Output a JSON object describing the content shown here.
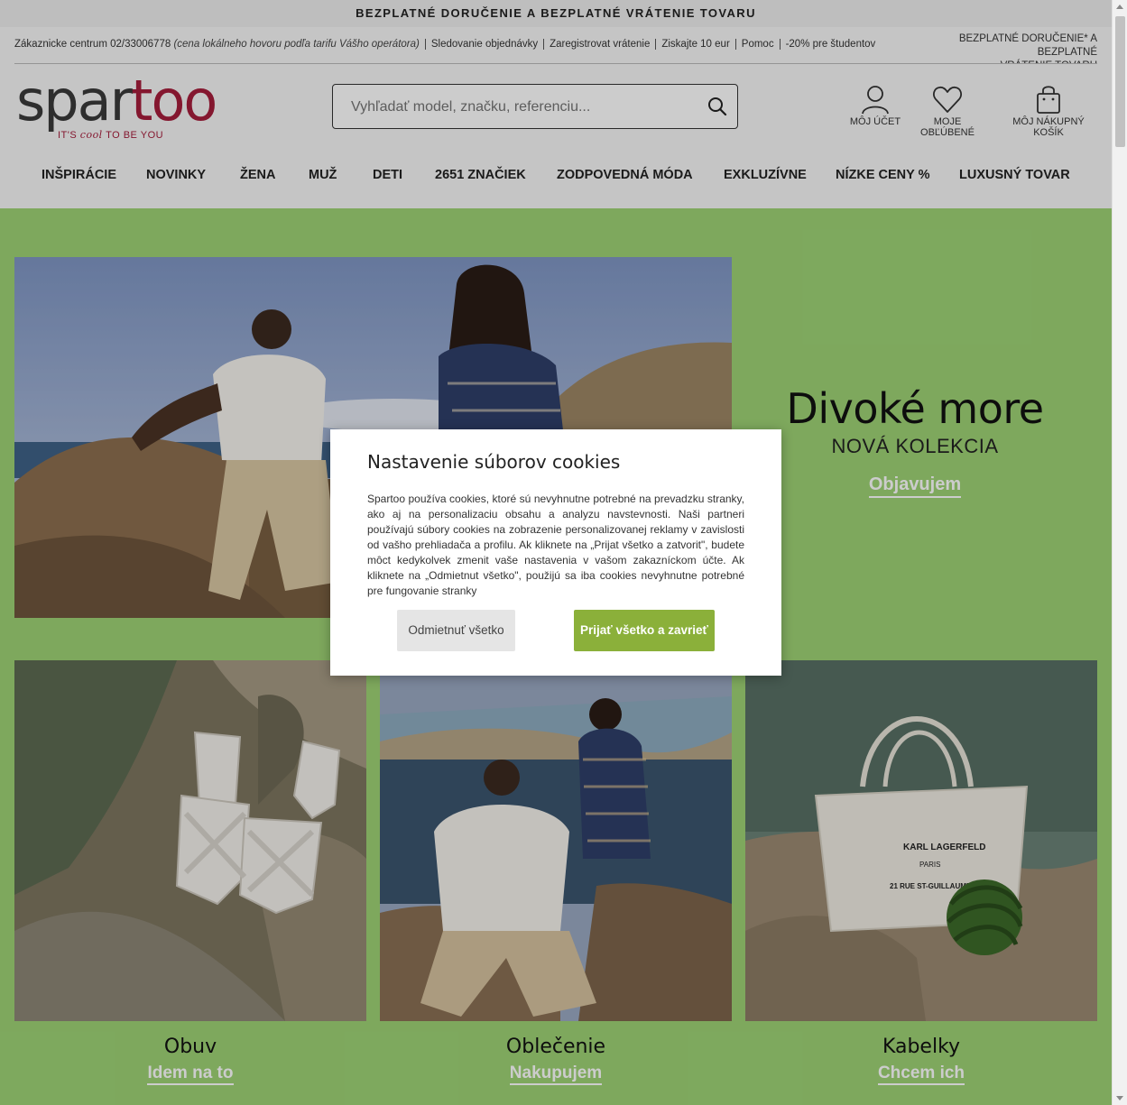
{
  "promo": {
    "text": "BEZPLATNÉ DORUČENIE A BEZPLATNÉ VRÁTENIE TOVARU"
  },
  "utility": {
    "customer_center": "Zákaznicke centrum 02/33006778",
    "customer_center_note": "(cena lokálneho hovoru podľa tarifu Vášho operátora)",
    "links": [
      "Sledovanie objednávky",
      "Zaregistrovat vrátenie",
      "Ziskajte 10 eur",
      "Pomoc",
      "-20% pre študentov"
    ],
    "right_line1": "BEZPLATNÉ DORUČENIE* A BEZPLATNÉ",
    "right_line2": "VRÁTENIE TOVARU"
  },
  "logo": {
    "part1": "spar",
    "part2": "too",
    "tag_before": "IT'S ",
    "tag_italic": "cool",
    "tag_after": " TO BE YOU",
    "brand_color": "#a61d3b"
  },
  "search": {
    "placeholder": "Vyhľadať model, značku, referenciu..."
  },
  "header_icons": {
    "account": "MÔJ ÚČET",
    "favorites": "MOJE OBĽÚBENÉ",
    "cart": "MÔJ NÁKUPNÝ KOŠÍK"
  },
  "nav": [
    "INŠPIRÁCIE",
    "NOVINKY",
    "ŽENA",
    "MUŽ",
    "DETI",
    "2651 ZNAČIEK",
    "ZODPOVEDNÁ MÓDA",
    "EXKLUZÍVNE",
    "NÍZKE CENY %",
    "LUXUSNÝ TOVAR"
  ],
  "hero": {
    "title": "Divoké more",
    "subtitle": "NOVÁ KOLEKCIA",
    "cta": "Objavujem",
    "bg_color": "#9ed375"
  },
  "tiles": [
    {
      "title": "Obuv",
      "cta": "Idem na to"
    },
    {
      "title": "Oblečenie",
      "cta": "Nakupujem"
    },
    {
      "title": "Kabelky",
      "cta": "Chcem ich",
      "bag_text1": "KARL LAGERFELD",
      "bag_text2": "PARIS",
      "bag_text3": "21 RUE ST-GUILLAUME"
    }
  ],
  "cookie_modal": {
    "title": "Nastavenie súborov cookies",
    "body": "Spartoo používa cookies, ktoré sú nevyhnutne potrebné na prevadzku stranky, ako aj na personalizaciu obsahu a analyzu navstevnosti. Naši partneri používajú súbory cookies na zobrazenie personalizovanej reklamy v zavislosti od vašho prehliadača a profilu. Ak kliknete na „Prijat všetko a zatvorit\", budete môct kedykolvek zmenit vaše nastavenia v vašom zakazníckom účte. Ak kliknete na „Odmietnut všetko\", použijú sa iba cookies nevyhnutne potrebné pre fungovanie stranky",
    "deny": "Odmietnuť všetko",
    "accept": "Prijať všetko a zavrieť",
    "accept_color": "#8bb03a"
  }
}
